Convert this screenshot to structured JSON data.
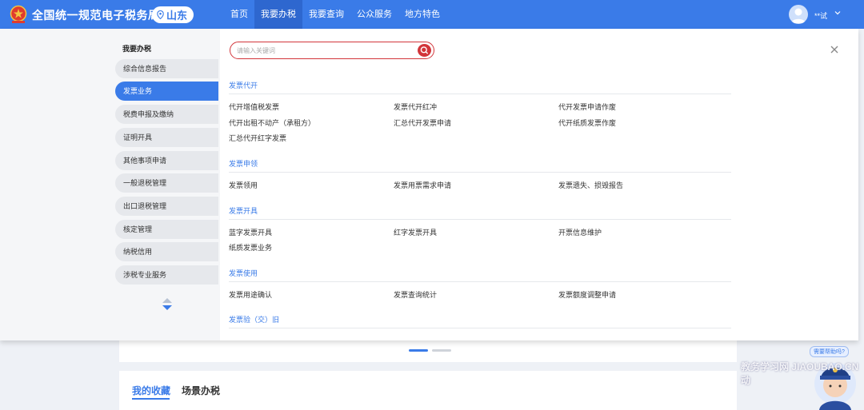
{
  "header": {
    "site_title": "全国统一规范电子税务局",
    "region": "山东",
    "nav": [
      "首页",
      "我要办税",
      "我要查询",
      "公众服务",
      "地方特色"
    ],
    "active_nav": "我要办税",
    "username": "**试"
  },
  "panel": {
    "sidebar": {
      "title": "我要办税",
      "items": [
        "综合信息报告",
        "发票业务",
        "税费申报及缴纳",
        "证明开具",
        "其他事项申请",
        "一般退税管理",
        "出口退税管理",
        "核定管理",
        "纳税信用",
        "涉税专业服务"
      ],
      "active_item": "发票业务"
    },
    "search": {
      "placeholder": "请输入关键词"
    },
    "sections": [
      {
        "title": "发票代开",
        "rows": [
          [
            "代开增值税发票",
            "发票代开红冲",
            "代开发票申请作废"
          ],
          [
            "代开出租不动产（承租方）",
            "汇总代开发票申请",
            "代开纸质发票作废"
          ],
          [
            "汇总代开红字发票"
          ]
        ]
      },
      {
        "title": "发票申领",
        "rows": [
          [
            "发票领用",
            "发票用票需求申请",
            "发票遗失、损毁报告"
          ]
        ]
      },
      {
        "title": "发票开具",
        "rows": [
          [
            "蓝字发票开具",
            "红字发票开具",
            "开票信息维护"
          ],
          [
            "纸质发票业务"
          ]
        ]
      },
      {
        "title": "发票使用",
        "rows": [
          [
            "发票用途确认",
            "发票查询统计",
            "发票额度调整申请"
          ]
        ]
      },
      {
        "title": "发票验（交）旧",
        "rows": []
      }
    ]
  },
  "background": {
    "tabs": [
      "我的收藏",
      "场景办税"
    ],
    "help_bubble": "需要帮助吗?",
    "watermark": "教务学习网 JIAOUBAO.CN 动"
  },
  "colors": {
    "brand": "#3a7be8",
    "search_accent": "#d2353a"
  }
}
